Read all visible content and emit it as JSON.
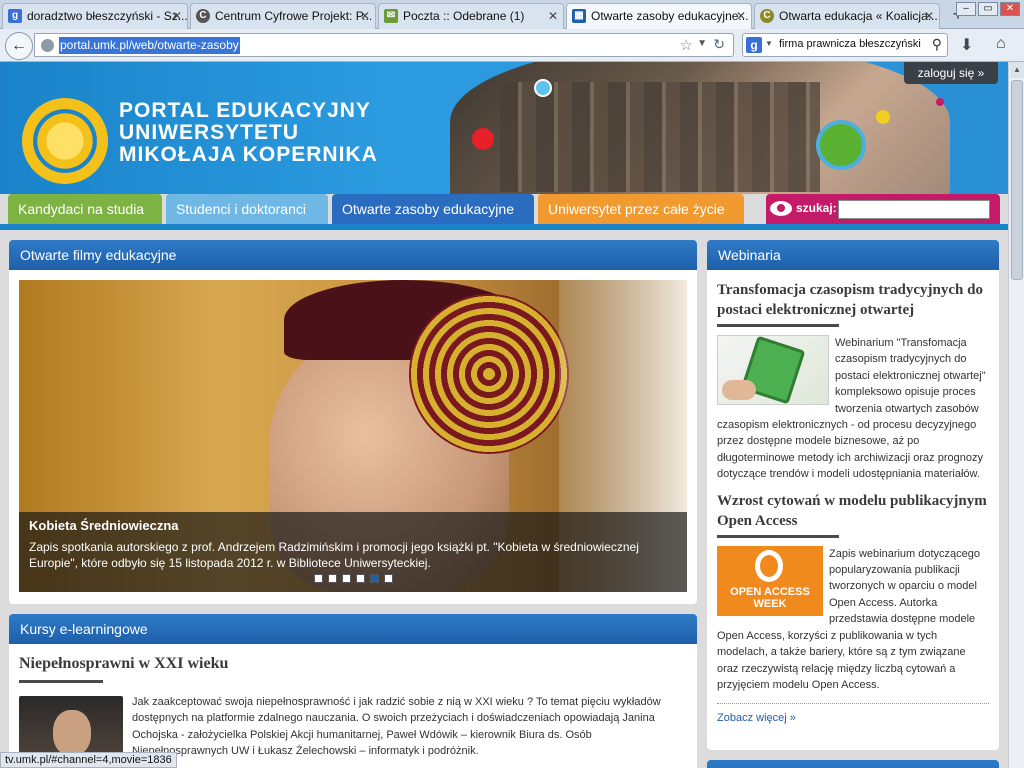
{
  "tabs": [
    {
      "label": "doradztwo błeszczyński - Sz...",
      "favicon": "google-icon",
      "active": false
    },
    {
      "label": "Centrum Cyfrowe Projekt: P...",
      "favicon": "cc-icon",
      "active": false
    },
    {
      "label": "Poczta :: Odebrane (1)",
      "favicon": "mail-icon",
      "active": false
    },
    {
      "label": "Otwarte zasoby edukacyjne...",
      "favicon": "umk-icon",
      "active": true
    },
    {
      "label": "Otwarta edukacja « Koalicja...",
      "favicon": "cc-icon",
      "active": false
    }
  ],
  "toolbar": {
    "url": "portal.umk.pl/web/otwarte-zasoby",
    "search_text": "firma prawnicza błeszczyński",
    "new_tab": "+"
  },
  "header": {
    "logo_lines": [
      "PORTAL EDUKACYJNY",
      "UNIWERSYTETU",
      "MIKOŁAJA KOPERNIKA"
    ],
    "login": "zaloguj się »"
  },
  "menu": {
    "items": [
      "Kandydaci na studia",
      "Studenci i doktoranci",
      "Otwarte zasoby edukacyjne",
      "Uniwersytet przez całe życie"
    ],
    "search_label": "szukaj:"
  },
  "films": {
    "heading": "Otwarte filmy edukacyjne",
    "title": "Kobieta Średniowieczna",
    "description": "Zapis spotkania autorskiego z prof. Andrzejem Radzimińskim i promocji jego książki pt. \"Kobieta w średniowiecznej Europie\", które odbyło się 15 listopada 2012 r. w Bibliotece Uniwersyteckiej.",
    "slides": 6,
    "active_slide": 5
  },
  "courses": {
    "heading": "Kursy e-learningowe",
    "title": "Niepełnosprawni w XXI wieku",
    "text": "Jak zaakceptować swoja niepełnosprawność i jak radzić sobie z nią w XXI wieku ? To temat pięciu wykładów dostępnych na platformie zdalnego nauczania. O swoich przeżyciach i doświadczeniach opowiadają Janina Ochojska - założycielka Polskiej Akcji humanitarnej, Paweł Wdówik – kierownik Biura ds. Osób Niepełnosprawnych UW i Łukasz Żelechowski – informatyk i podróżnik."
  },
  "webinars": {
    "heading": "Webinaria",
    "items": [
      {
        "title": "Transfomacja czasopism tradycyjnych do postaci elektronicznej otwartej",
        "text": "Webinarium \"Transfomacja czasopism tradycyjnych do postaci elektronicznej otwartej\" kompleksowo opisuje proces tworzenia otwartych zasobów czasopism elektronicznych - od procesu decyzyjnego przez dostępne modele biznesowe, aż po długoterminowe metody ich archiwizacji oraz prognozy dotyczące trendów i modeli udostępniania materiałów."
      },
      {
        "title": "Wzrost cytowań w modelu publikacyjnym Open Access",
        "text": "Zapis webinarium dotyczącego popularyzowania publikacji tworzonych w oparciu o model Open Access. Autorka przedstawia dostępne modele Open Access, korzyści z publikowania w tych modelach, a także bariery, które są z tym związane oraz rzeczywistą relację między liczbą cytowań a przyjęciem modelu Open Access.",
        "badge": [
          "OPEN ACCESS",
          "WEEK"
        ]
      }
    ],
    "more": "Zobacz więcej »"
  },
  "status": "tv.umk.pl/#channel=4,movie=1836",
  "colors": {
    "green": "#7cb342",
    "lightblue": "#6fb8e6",
    "navy": "#2a6cc0",
    "orange": "#f09a30",
    "pink": "#c41b69"
  }
}
